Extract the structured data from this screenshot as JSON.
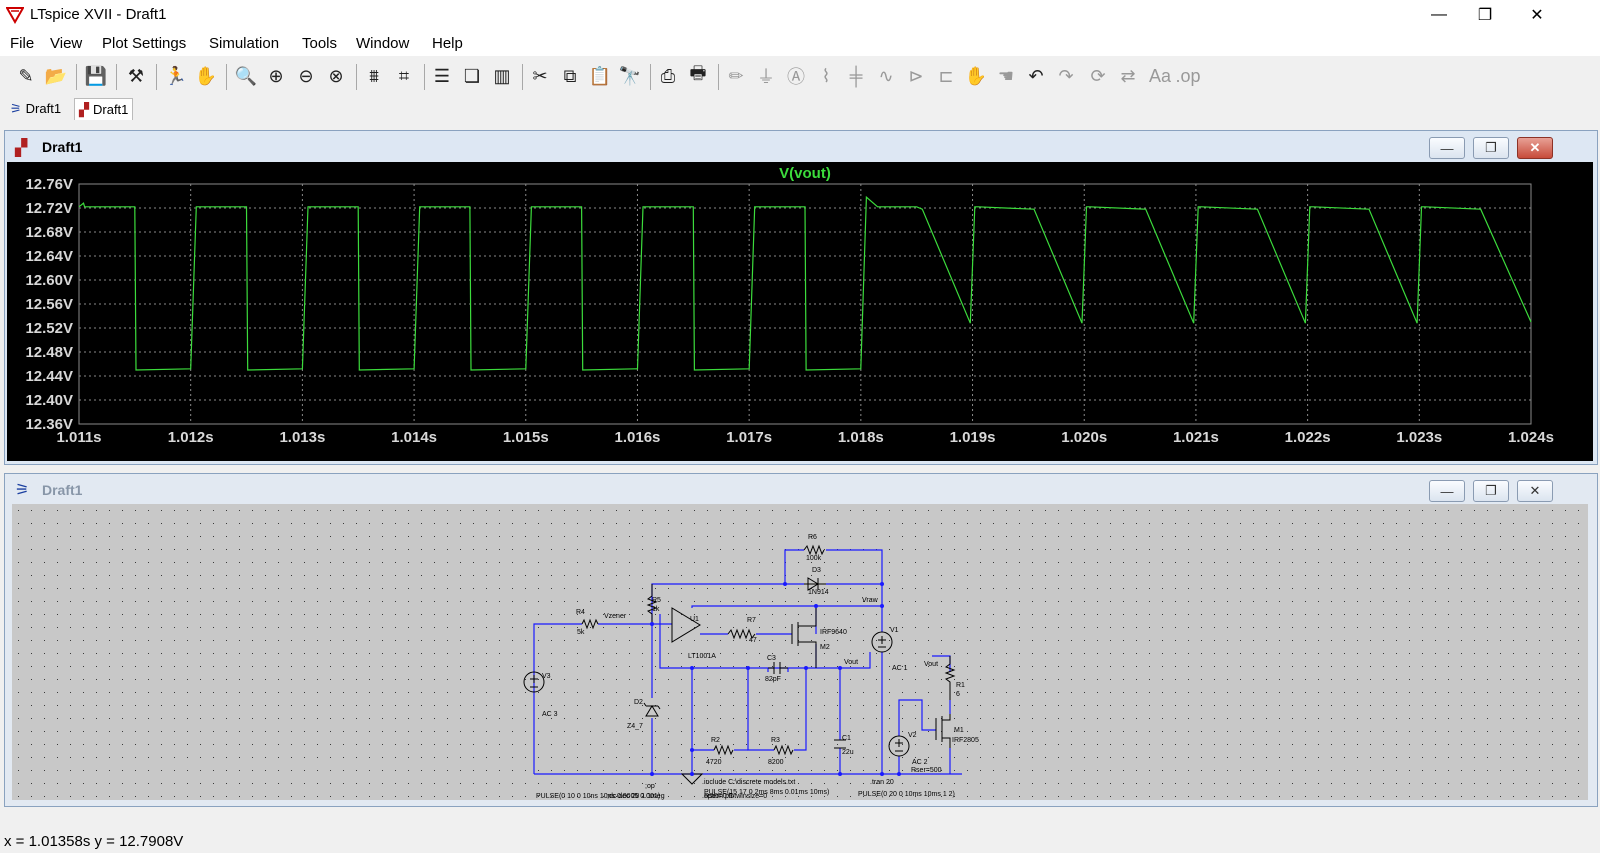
{
  "window": {
    "title": "LTspice XVII - Draft1",
    "minimize": "—",
    "maximize": "❐",
    "close": "✕"
  },
  "menu": [
    "File",
    "View",
    "Plot Settings",
    "Simulation",
    "Tools",
    "Window",
    "Help"
  ],
  "toolbar": {
    "icons": [
      "new-schematic-icon",
      "open-icon",
      "save-icon",
      "control-panel-icon",
      "run-icon",
      "halt-icon",
      "zoom-area-icon",
      "zoom-in-icon",
      "zoom-out-icon",
      "zoom-fit-icon",
      "autorange-icon",
      "mark-unit-icon",
      "tile-horizontal-icon",
      "cascade-icon",
      "tile-vertical-icon",
      "cut-icon",
      "copy-icon",
      "paste-icon",
      "find-icon",
      "print-icon",
      "print-setup-icon",
      "wire-icon",
      "ground-icon",
      "label-net-icon",
      "resistor-icon",
      "capacitor-icon",
      "inductor-icon",
      "diode-icon",
      "component-icon",
      "move-icon",
      "drag-icon",
      "undo-icon",
      "redo-icon",
      "rotate-icon",
      "mirror-icon",
      "text-icon",
      "spice-directive-icon"
    ]
  },
  "tabs": [
    {
      "label": "Draft1",
      "icon": "schematic-icon",
      "active": false
    },
    {
      "label": "Draft1",
      "icon": "waveform-icon",
      "active": true
    }
  ],
  "plot_window": {
    "title": "Draft1",
    "buttons": {
      "minimize": "—",
      "restore": "❐",
      "close": "✕"
    }
  },
  "schematic_window": {
    "title": "Draft1",
    "buttons": {
      "minimize": "—",
      "restore": "❐",
      "close": "✕"
    }
  },
  "colors": {
    "plot_bg": "#000000",
    "trace": "#3cdc3c",
    "grid": "#8a8a8a",
    "axis_text": "#d8d8d8",
    "wire": "#1a1aff",
    "schematic_bg": "#c8c8c8"
  },
  "chart_data": {
    "type": "line",
    "title": "V(vout)",
    "xlabel": "",
    "ylabel": "",
    "x_ticks": [
      "1.011s",
      "1.012s",
      "1.013s",
      "1.014s",
      "1.015s",
      "1.016s",
      "1.017s",
      "1.018s",
      "1.019s",
      "1.020s",
      "1.021s",
      "1.022s",
      "1.023s",
      "1.024s"
    ],
    "y_ticks": [
      "12.76V",
      "12.72V",
      "12.68V",
      "12.64V",
      "12.60V",
      "12.56V",
      "12.52V",
      "12.48V",
      "12.44V",
      "12.40V",
      "12.36V"
    ],
    "xlim": [
      1.011,
      1.024
    ],
    "ylim": [
      12.36,
      12.76
    ],
    "grid": true,
    "series": [
      {
        "name": "V(vout)",
        "x": [
          1.011,
          1.01104,
          1.01105,
          1.0115,
          1.01151,
          1.012,
          1.01205,
          1.0125,
          1.01251,
          1.013,
          1.01305,
          1.0135,
          1.01351,
          1.014,
          1.01405,
          1.0145,
          1.01451,
          1.015,
          1.01505,
          1.0155,
          1.01551,
          1.016,
          1.01605,
          1.0165,
          1.01651,
          1.017,
          1.01705,
          1.0175,
          1.01751,
          1.018,
          1.01805,
          1.01815,
          1.0185,
          1.01855,
          1.01898,
          1.01902,
          1.01905,
          1.01955,
          1.01998,
          1.02002,
          1.02005,
          1.02055,
          1.02098,
          1.02102,
          1.02105,
          1.02155,
          1.02198,
          1.02202,
          1.02205,
          1.02255,
          1.02298,
          1.02302,
          1.02305,
          1.02355,
          1.024
        ],
        "y": [
          12.722,
          12.728,
          12.722,
          12.722,
          12.45,
          12.452,
          12.722,
          12.722,
          12.45,
          12.452,
          12.722,
          12.722,
          12.45,
          12.452,
          12.722,
          12.722,
          12.45,
          12.452,
          12.722,
          12.722,
          12.45,
          12.452,
          12.722,
          12.722,
          12.45,
          12.452,
          12.722,
          12.722,
          12.45,
          12.452,
          12.738,
          12.722,
          12.722,
          12.718,
          12.528,
          12.722,
          12.722,
          12.718,
          12.528,
          12.722,
          12.722,
          12.718,
          12.528,
          12.722,
          12.722,
          12.718,
          12.528,
          12.722,
          12.722,
          12.718,
          12.528,
          12.722,
          12.722,
          12.718,
          12.53
        ]
      }
    ]
  },
  "schematic": {
    "labels": [
      {
        "text": "R6",
        "id": "r6"
      },
      {
        "text": "100k",
        "id": "r6v"
      },
      {
        "text": "D3",
        "id": "d3"
      },
      {
        "text": "1N914",
        "id": "d3v"
      },
      {
        "text": "Vraw",
        "id": "vraw"
      },
      {
        "text": "R5",
        "id": "r5"
      },
      {
        "text": "1k",
        "id": "r5v"
      },
      {
        "text": "U1",
        "id": "u1"
      },
      {
        "text": "R7",
        "id": "r7"
      },
      {
        "text": "47",
        "id": "r7v"
      },
      {
        "text": "IRF9640",
        "id": "m2m"
      },
      {
        "text": "M2",
        "id": "m2"
      },
      {
        "text": "V1",
        "id": "v1"
      },
      {
        "text": "R4",
        "id": "r4"
      },
      {
        "text": "5k",
        "id": "r4v"
      },
      {
        "text": "Vzener",
        "id": "vzener"
      },
      {
        "text": "LT1001A",
        "id": "u1m"
      },
      {
        "text": "C3",
        "id": "c3"
      },
      {
        "text": "82pF",
        "id": "c3v"
      },
      {
        "text": "Vout",
        "id": "vout1"
      },
      {
        "text": "AC 1",
        "id": "v1ac"
      },
      {
        "text": "Vout",
        "id": "vout2"
      },
      {
        "text": "R1",
        "id": "r1"
      },
      {
        "text": "6",
        "id": "r1v"
      },
      {
        "text": "V3",
        "id": "v3"
      },
      {
        "text": "D2",
        "id": "d2"
      },
      {
        "text": "Z4_7",
        "id": "d2v"
      },
      {
        "text": "AC 3",
        "id": "v3ac"
      },
      {
        "text": "M1",
        "id": "m1"
      },
      {
        "text": "IRF2805",
        "id": "m1m"
      },
      {
        "text": "C1",
        "id": "c1"
      },
      {
        "text": "22u",
        "id": "c1v"
      },
      {
        "text": "V2",
        "id": "v2"
      },
      {
        "text": "R2",
        "id": "r2"
      },
      {
        "text": "4720",
        "id": "r2v"
      },
      {
        "text": "R3",
        "id": "r3"
      },
      {
        "text": "8200",
        "id": "r3v"
      },
      {
        "text": "AC 2",
        "id": "v2ac"
      },
      {
        "text": "Rser=500",
        "id": "v2rs"
      }
    ],
    "directives": [
      {
        "text": ";op",
        "id": "d_op"
      },
      {
        "text": ";dc dec 20 1 1meg",
        "id": "d_dc"
      },
      {
        "text": "PULSE(0 10 0 10ns 10ns 0.0005 0.001)",
        "id": "d_pv3"
      },
      {
        "text": ".include C:\\discrete models.txt",
        "id": "d_inc"
      },
      {
        "text": "PULSE(15 17 0 2ms 8ms 0.01ms 10ms)",
        "id": "d_pv1"
      },
      {
        "text": "Rser=0.5",
        "id": "d_rser"
      },
      {
        "text": ".option plotwinsize=0",
        "id": "d_opt"
      },
      {
        "text": ".tran 20",
        "id": "d_tran"
      },
      {
        "text": "PULSE(0 20 0 10ms 10ms 1 2)",
        "id": "d_pv2"
      }
    ]
  },
  "status": {
    "readout": "x = 1.01358s    y = 12.7908V"
  }
}
